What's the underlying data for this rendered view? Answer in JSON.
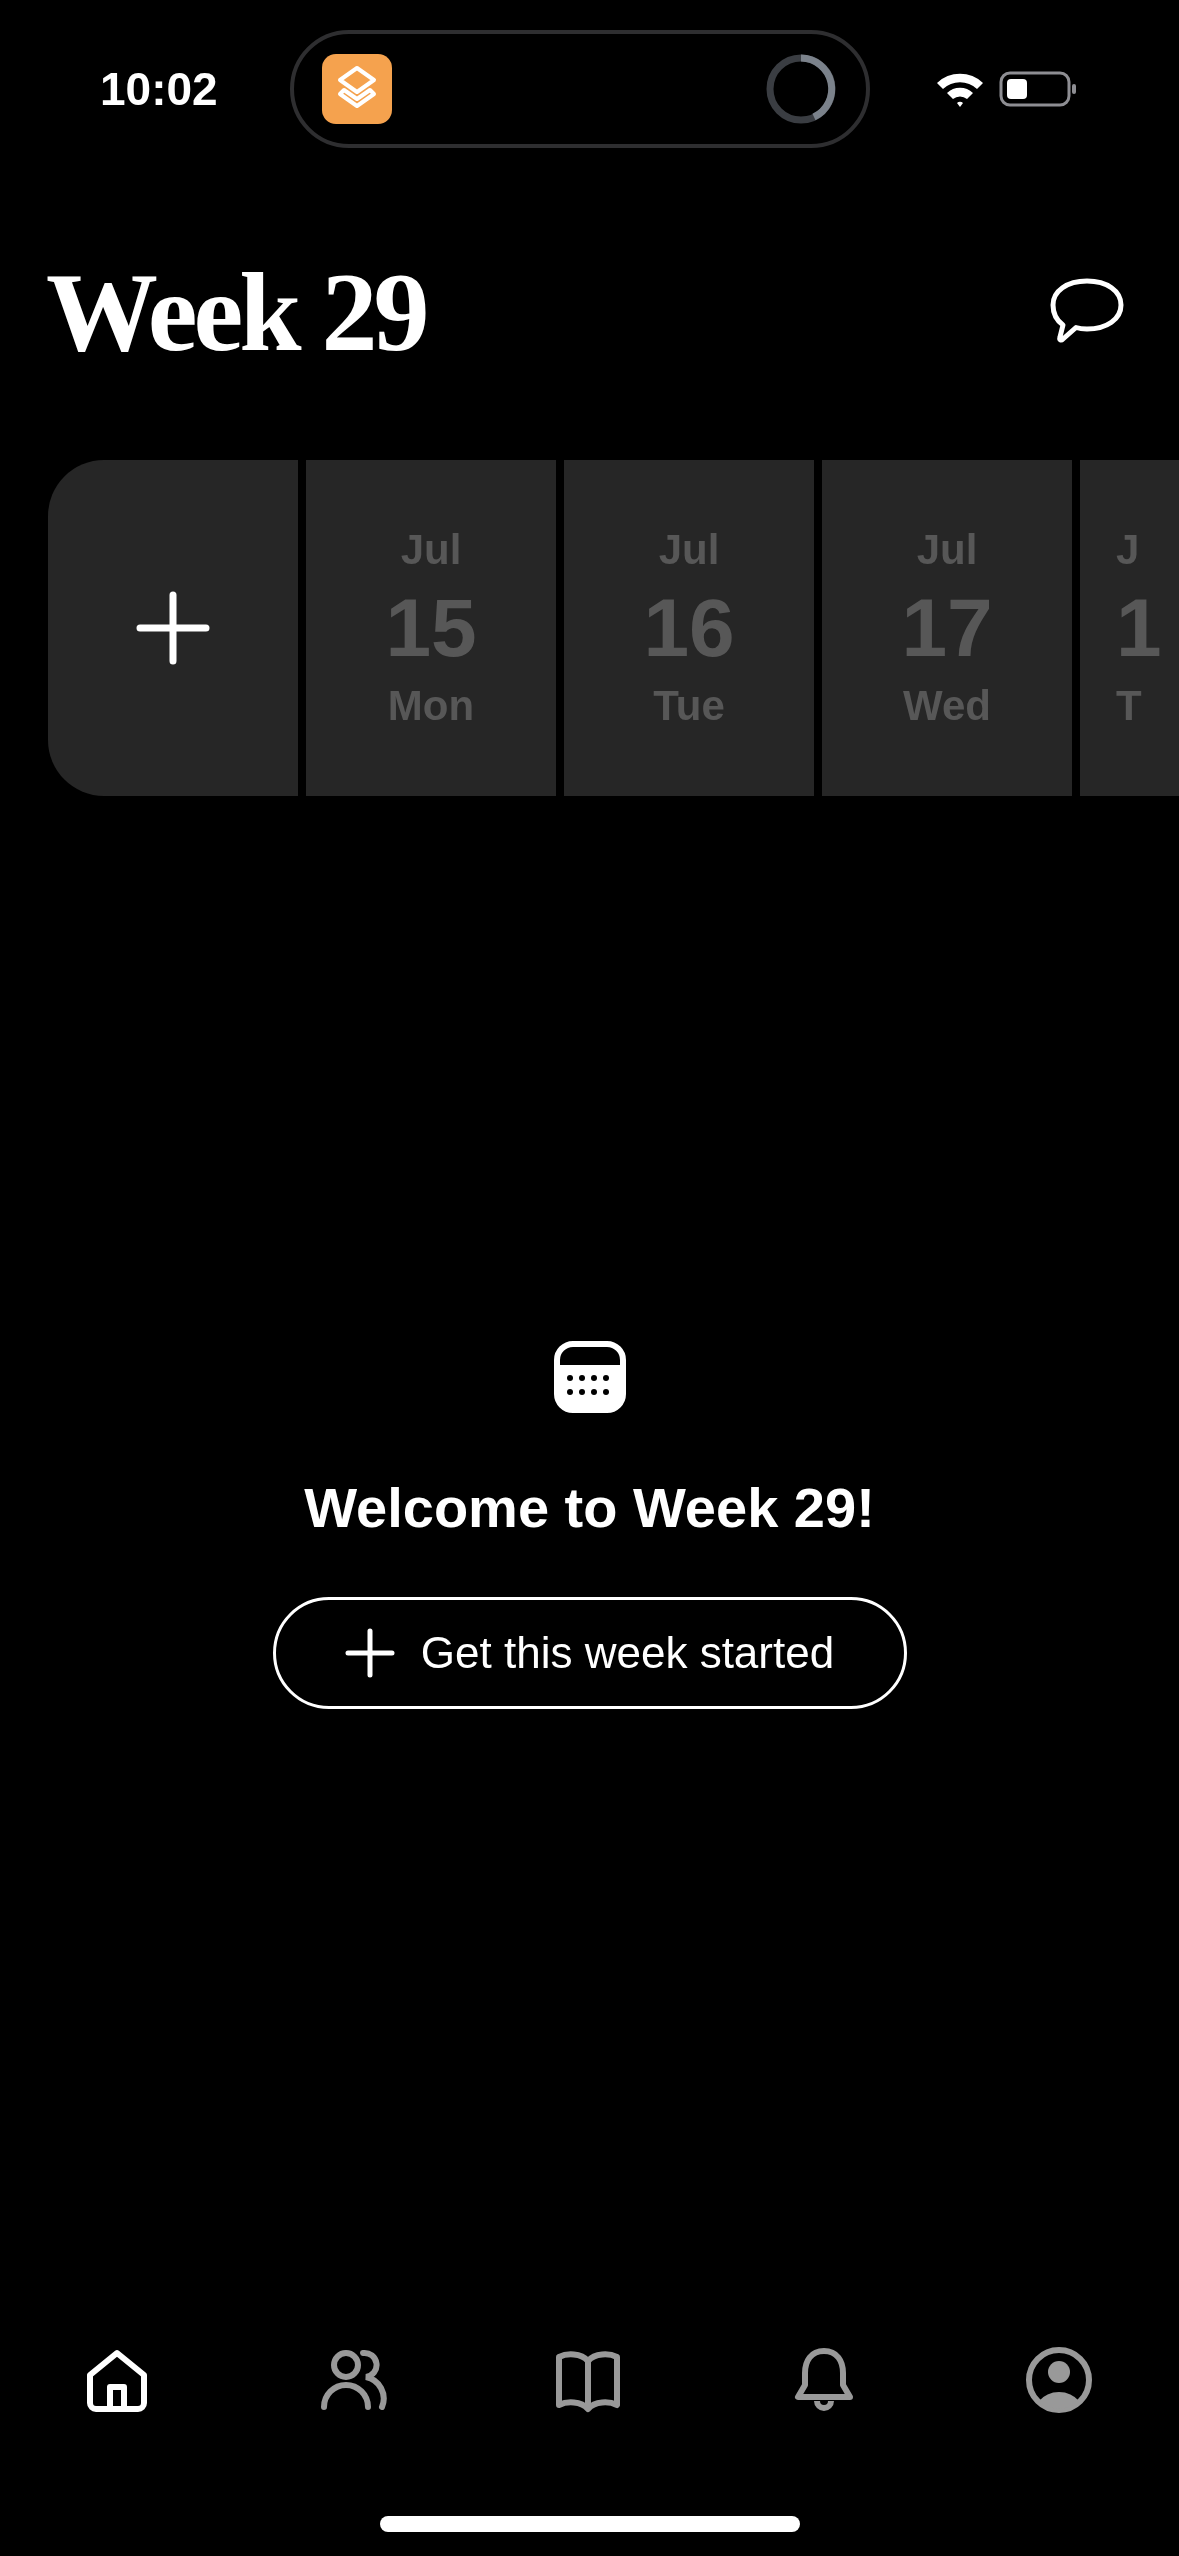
{
  "status_bar": {
    "time": "10:02"
  },
  "header": {
    "title": "Week 29"
  },
  "day_strip": {
    "days": [
      {
        "kind": "full",
        "month": "Jul",
        "day": "15",
        "weekday": "Mon"
      },
      {
        "kind": "full",
        "month": "Jul",
        "day": "16",
        "weekday": "Tue"
      },
      {
        "kind": "full",
        "month": "Jul",
        "day": "17",
        "weekday": "Wed"
      },
      {
        "kind": "partial",
        "month": "J",
        "day": "1",
        "weekday": "T"
      }
    ]
  },
  "empty_state": {
    "title": "Welcome to Week 29!",
    "button": "Get this week started"
  },
  "tab_bar": {
    "items": [
      {
        "kind": "home",
        "selected": true
      },
      {
        "kind": "people",
        "selected": false
      },
      {
        "kind": "book",
        "selected": false
      },
      {
        "kind": "bell",
        "selected": false
      },
      {
        "kind": "profile",
        "selected": false
      }
    ]
  }
}
